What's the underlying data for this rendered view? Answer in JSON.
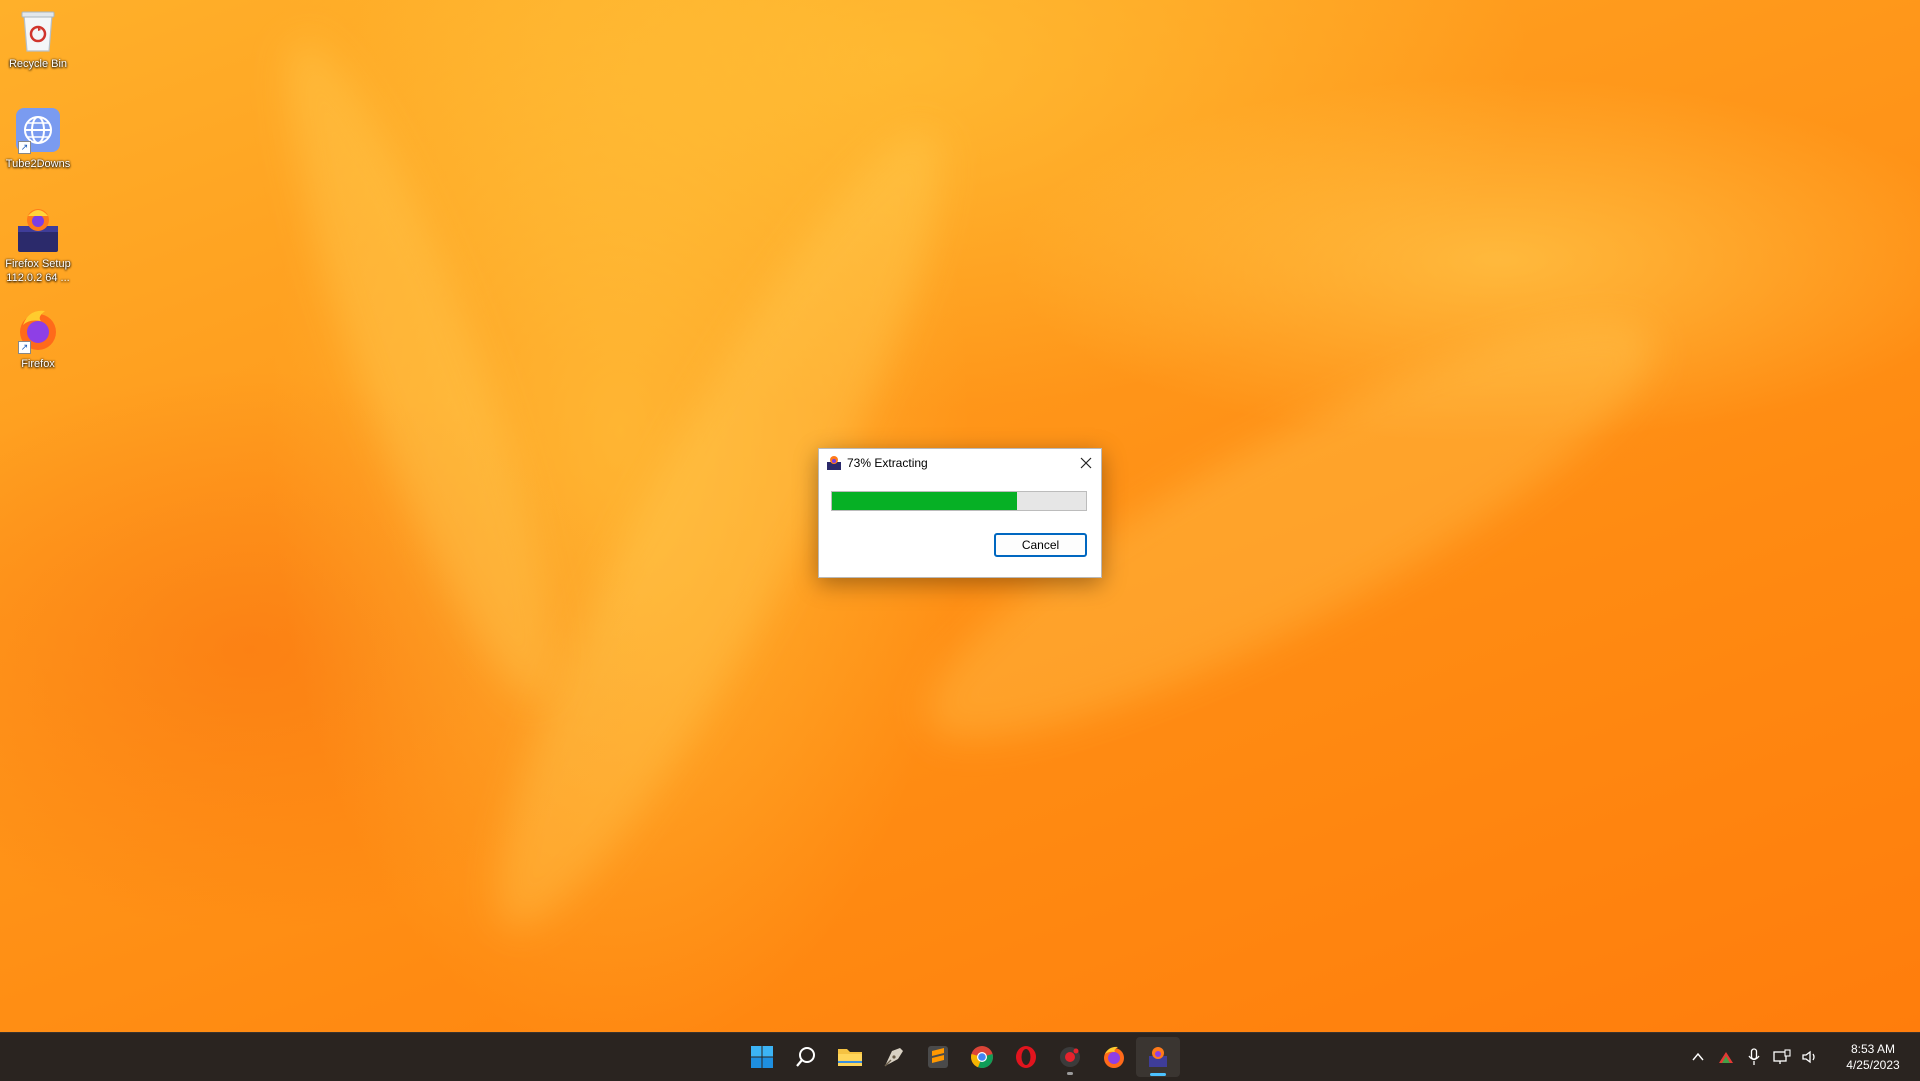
{
  "desktop": {
    "icons": [
      {
        "label": "Recycle Bin",
        "icon": "recycle-bin-icon"
      },
      {
        "label": "Tube2Downs",
        "icon": "globe-icon"
      },
      {
        "label": "Firefox Setup 112.0.2 64 ...",
        "icon": "firefox-installer-icon"
      },
      {
        "label": "Firefox",
        "icon": "firefox-icon"
      }
    ]
  },
  "dialog": {
    "title": "73% Extracting",
    "progress_percent": 73,
    "cancel_label": "Cancel",
    "progress_color": "#06b025",
    "button_border_color": "#0067c0"
  },
  "taskbar": {
    "apps": [
      {
        "name": "start",
        "icon": "windows-logo-icon"
      },
      {
        "name": "search",
        "icon": "search-icon"
      },
      {
        "name": "file-explorer",
        "icon": "folder-icon"
      },
      {
        "name": "pen-tool",
        "icon": "pen-icon"
      },
      {
        "name": "sublime-text",
        "icon": "sublime-icon"
      },
      {
        "name": "chrome",
        "icon": "chrome-icon"
      },
      {
        "name": "opera",
        "icon": "opera-icon"
      },
      {
        "name": "recorder",
        "icon": "camera-icon"
      },
      {
        "name": "firefox",
        "icon": "firefox-icon"
      },
      {
        "name": "installer",
        "icon": "installer-icon"
      }
    ],
    "tray": [
      "chevron-up-icon",
      "network-warning-icon",
      "microphone-icon",
      "display-icon",
      "speaker-icon"
    ],
    "time": "8:53 AM",
    "date": "4/25/2023"
  }
}
